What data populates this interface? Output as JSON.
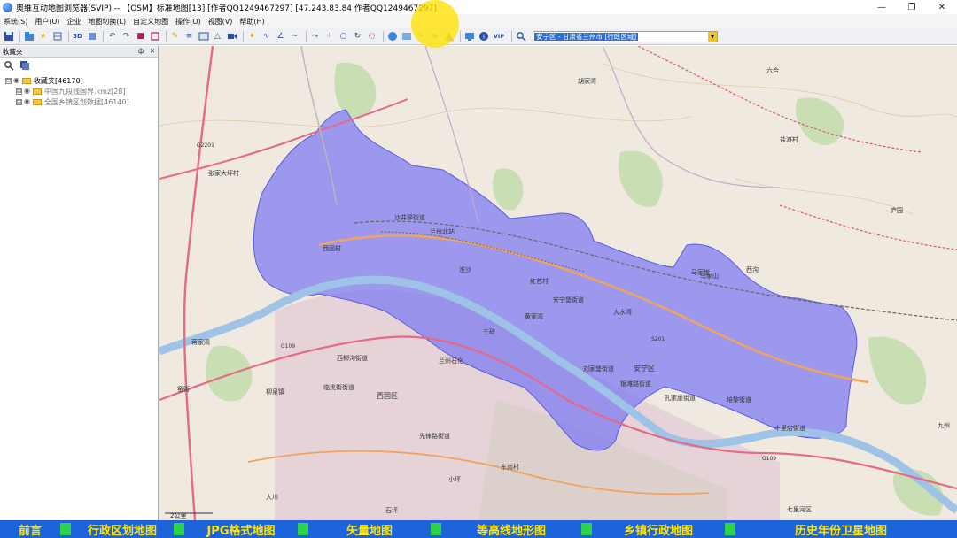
{
  "window": {
    "title": "奥维互动地图浏览器(SVIP) -- 【OSM】标准地图[13] [作者QQ1249467297] [47.243.83.84 作者QQ1249467297]",
    "controls": [
      "—",
      "❐",
      "✕"
    ]
  },
  "menu": [
    "系统(S)",
    "用户(U)",
    "企业",
    "地图切换(L)",
    "自定义地图",
    "操作(O)",
    "视图(V)",
    "帮助(H)"
  ],
  "toolbar": {
    "search_value": "安宁区 - 甘肃省兰州市 [行政区域]",
    "vip_label": "VIP"
  },
  "sidebar": {
    "title": "收藏夹",
    "pin": "ф",
    "close": "✕",
    "tree": [
      {
        "label": "收藏夹[46170]",
        "expander": "⊟"
      },
      {
        "label": "中国九段线国界.kmz[28]",
        "expander": "⊞"
      },
      {
        "label": "全国乡镇区划数据[46140]",
        "expander": "⊞"
      }
    ]
  },
  "map": {
    "scale_label": "2公里",
    "labels": {
      "shajing": "沙井驿街道",
      "liujiaxiang": "刘家堡街道",
      "anning": "安宁区",
      "kongjiaya": "孔家崖街道",
      "yinmenlu": "银滩路街道",
      "peili": "培黎街道",
      "shilidian": "十里店街道",
      "anningbao": "安宁堡街道",
      "xiliugou": "西柳沟街道",
      "linxiaolu": "临洮街街道",
      "xiguqu": "西固区",
      "xianfenglu": "先锋路街道",
      "lanzhoushihua": "兰州石化",
      "liujing": "柳泉镇",
      "dongguan": "东岗村",
      "yaoji": "窑街",
      "sanlu": "三砂",
      "qilihe": "七里河区",
      "s201": "S201",
      "g109": "G109",
      "g2201": "G2201",
      "g109b": "G109",
      "xigu_village": "西固村",
      "hujiawan": "胡家湾",
      "liuhe": "六合",
      "yantan": "盐滩村",
      "luyuan": "庐园",
      "xigou": "西沟",
      "lanzhoubei": "兰州北站",
      "huaisha": "淮沙",
      "zhangjia": "张家大坪村",
      "dachuan": "大川",
      "maji": "马家崖",
      "jiangjia": "蒋家湾",
      "xiaoping": "小坪",
      "jiuzhou": "九州",
      "shiping": "石坪",
      "majiashan": "马家山",
      "hongyi": "红艺村",
      "huangjiawan": "黄家湾",
      "dashuiwan": "大水湾"
    }
  },
  "bottom_nav": [
    "前言",
    "行政区划地图",
    "JPG格式地图",
    "矢量地图",
    "等高线地形图",
    "乡镇行政地图",
    "历史年份卫星地图"
  ]
}
